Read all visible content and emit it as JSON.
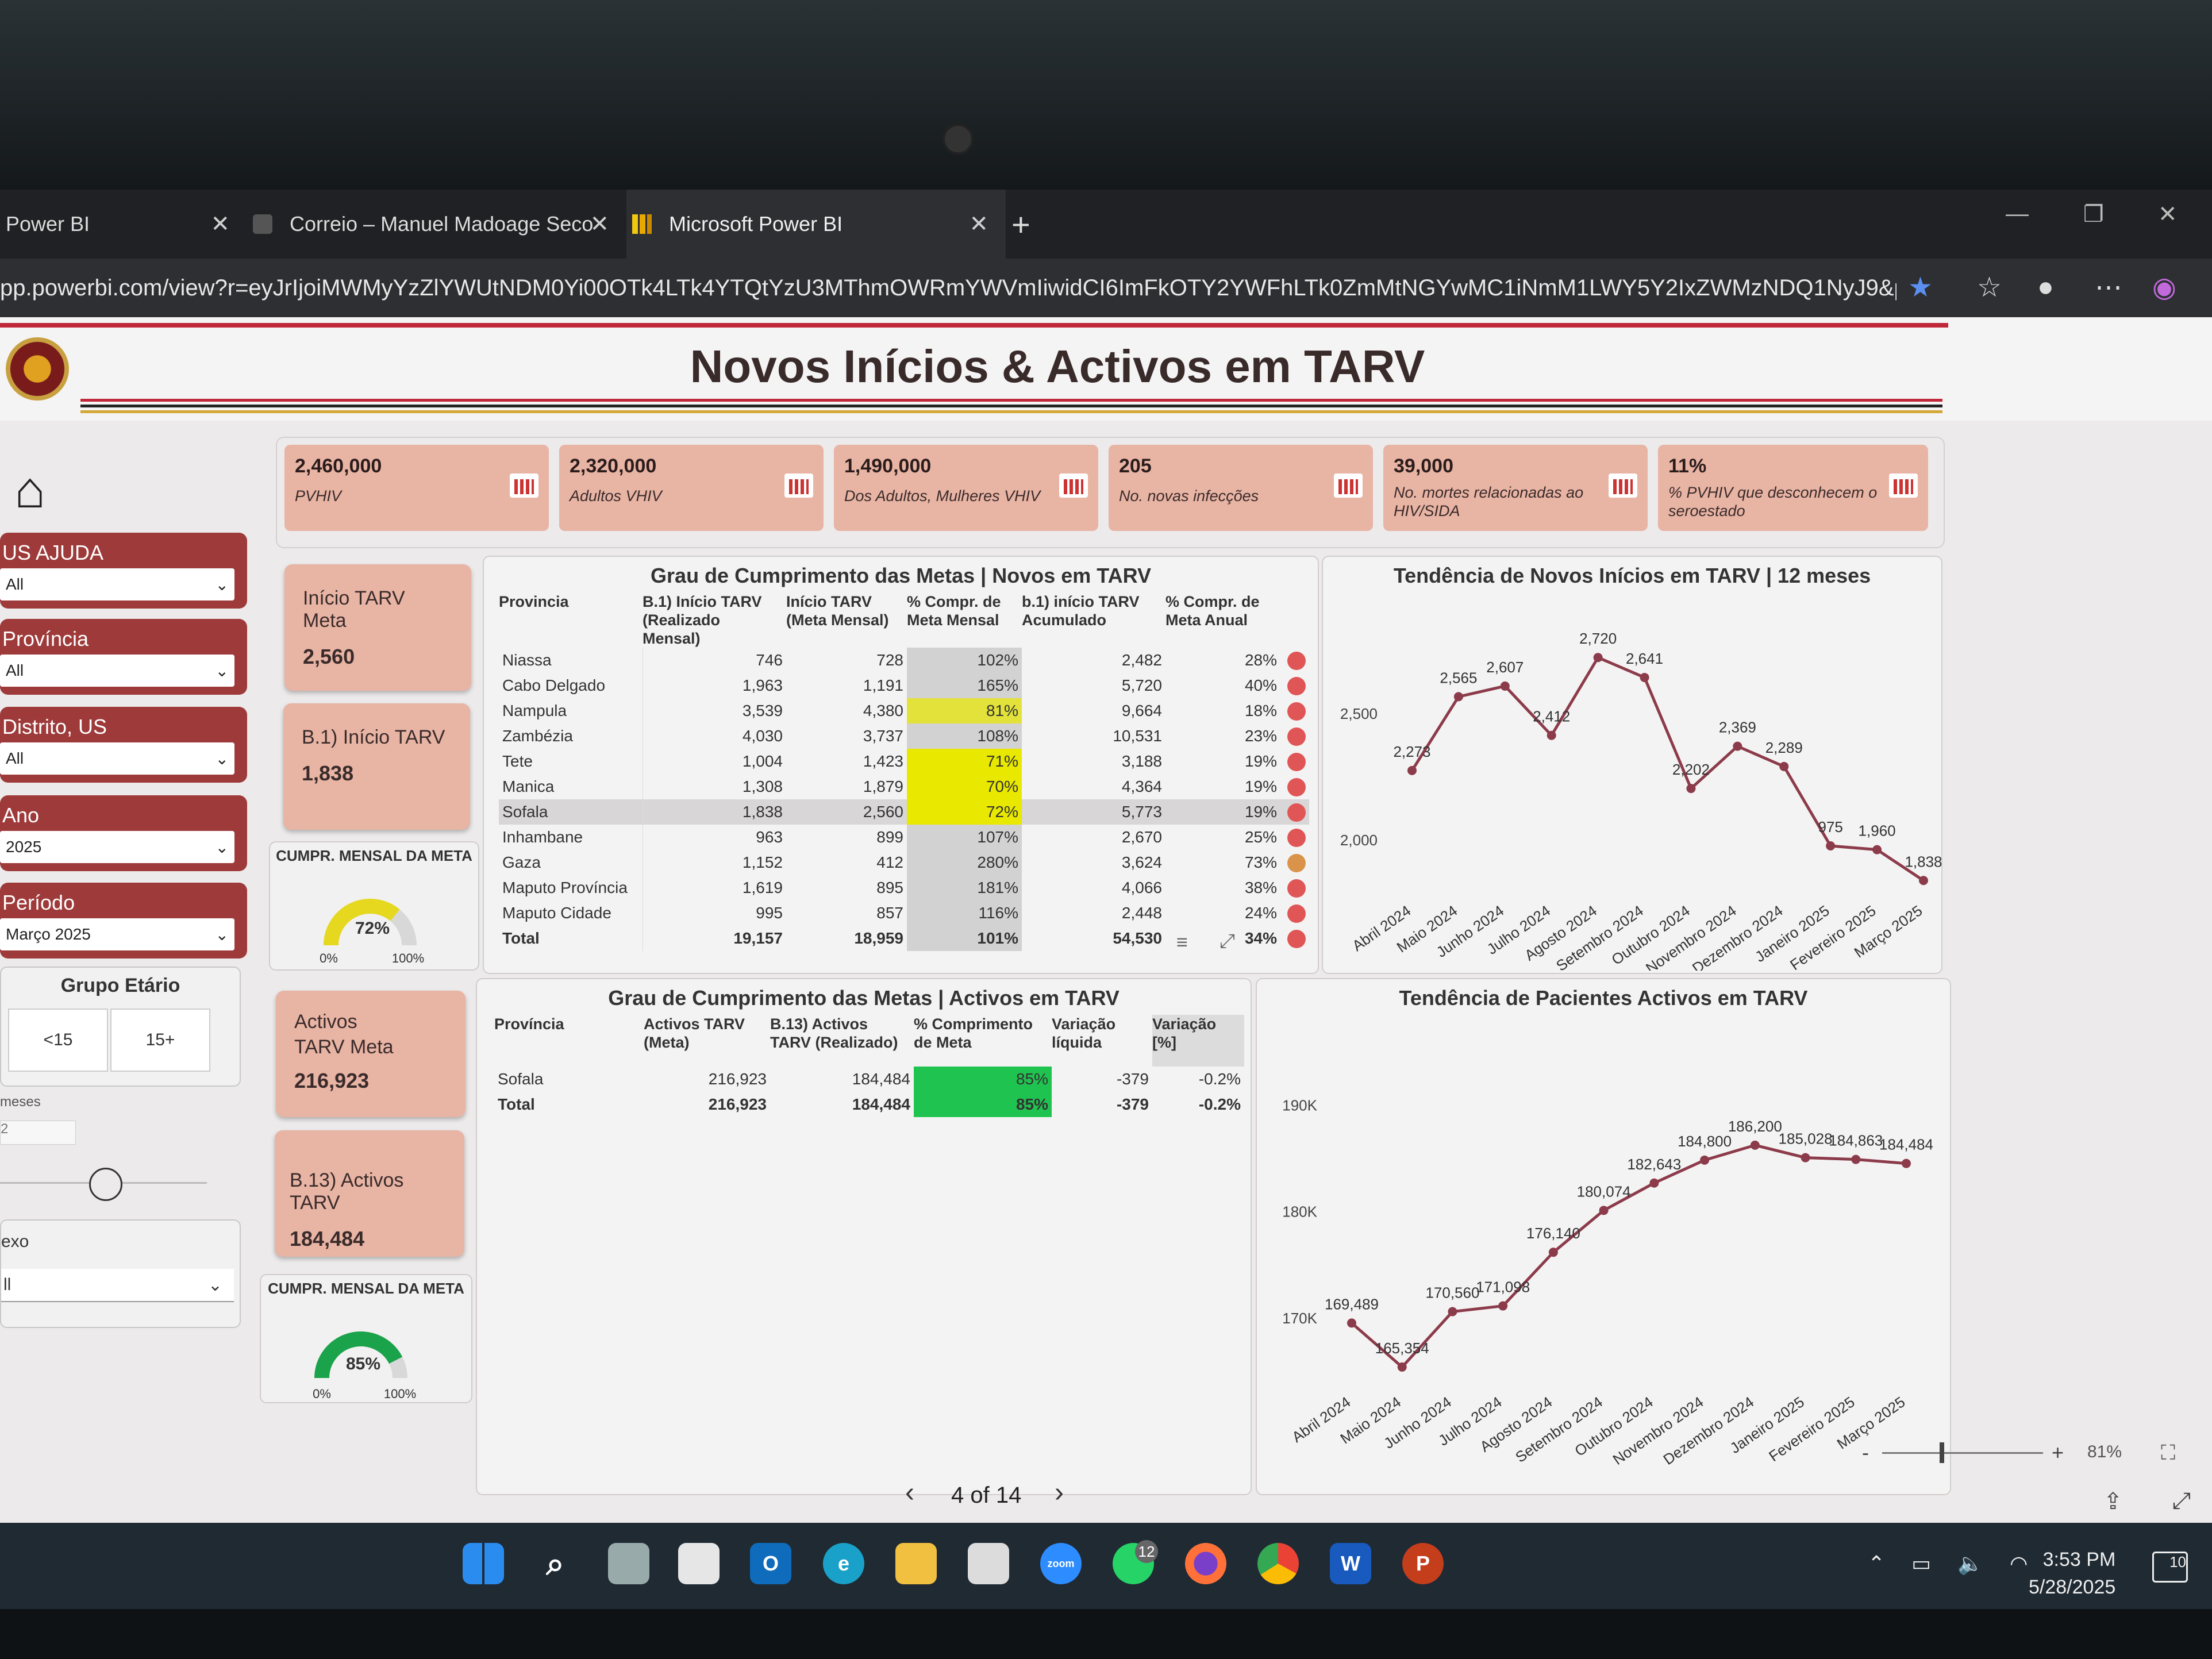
{
  "browser": {
    "tabs": [
      {
        "label": "Power BI"
      },
      {
        "label": "Correio – Manuel Madoage Seco"
      },
      {
        "label": "Microsoft Power BI"
      }
    ],
    "new_tab": "+",
    "url": "pp.powerbi.com/view?r=eyJrIjoiMWMyYzZlYWUtNDM0Yi00OTk4LTk4YTQtYzU3MThmOWRmYWVmIiwidCI6ImFkOTY2YWFhLTk0ZmMtNGYwMC1iNmM1LWY5Y2IxZWMzNDQ1NyJ9&pageNa..."
  },
  "report": {
    "title": "Novos Inícios & Activos em TARV",
    "filters": [
      {
        "label": "US AJUDA",
        "value": "All"
      },
      {
        "label": "Província",
        "value": "All"
      },
      {
        "label": "Distrito, US",
        "value": "All"
      },
      {
        "label": "Ano",
        "value": "2025"
      },
      {
        "label": "Período",
        "value": "Março 2025"
      }
    ],
    "age_group": {
      "label": "Grupo Etário",
      "options": [
        "<15",
        "15+"
      ]
    },
    "months_label": "meses",
    "months_value": "2",
    "sexo": {
      "label": "exo",
      "value": "ll"
    },
    "kpis": [
      {
        "value": "2,460,000",
        "label": "PVHIV"
      },
      {
        "value": "2,320,000",
        "label": "Adultos VHIV"
      },
      {
        "value": "1,490,000",
        "label": "Dos Adultos, Mulheres VHIV"
      },
      {
        "value": "205",
        "label": "No. novas infecções"
      },
      {
        "value": "39,000",
        "label": "No. mortes relacionadas ao HIV/SIDA"
      },
      {
        "value": "11%",
        "label": "% PVHIV que desconhecem o seroestado"
      }
    ],
    "cards": {
      "inicio_meta": {
        "title": "Início TARV Meta",
        "value": "2,560"
      },
      "inicio_tarv": {
        "title": "B.1) Início TARV",
        "value": "1,838"
      },
      "activos_meta": {
        "title": "Activos TARV Meta",
        "value": "216,923"
      },
      "activos_tarv": {
        "title": "B.13) Activos TARV",
        "value": "184,484"
      }
    },
    "gauge1": {
      "title": "CUMPR. MENSAL DA META",
      "value_label": "72%",
      "value": 0.72,
      "min": "0%",
      "max": "100%",
      "color": "#e6d81e"
    },
    "gauge2": {
      "title": "CUMPR. MENSAL DA META",
      "value_label": "85%",
      "value": 0.85,
      "min": "0%",
      "max": "100%",
      "color": "#1aa34a"
    },
    "novos_table": {
      "title": "Grau de Cumprimento das Metas | Novos em TARV",
      "headers": [
        "Provincia",
        "B.1) Início TARV (Realizado Mensal)",
        "Início TARV (Meta Mensal)",
        "% Compr. de Meta Mensal",
        "b.1) início TARV Acumulado",
        "% Compr. de Meta Anual"
      ],
      "rows": [
        [
          "Niassa",
          "746",
          "728",
          "102%",
          "2,482",
          "28%"
        ],
        [
          "Cabo Delgado",
          "1,963",
          "1,191",
          "165%",
          "5,720",
          "40%"
        ],
        [
          "Nampula",
          "3,539",
          "4,380",
          "81%",
          "9,664",
          "18%"
        ],
        [
          "Zambézia",
          "4,030",
          "3,737",
          "108%",
          "10,531",
          "23%"
        ],
        [
          "Tete",
          "1,004",
          "1,423",
          "71%",
          "3,188",
          "19%"
        ],
        [
          "Manica",
          "1,308",
          "1,879",
          "70%",
          "4,364",
          "19%"
        ],
        [
          "Sofala",
          "1,838",
          "2,560",
          "72%",
          "5,773",
          "19%"
        ],
        [
          "Inhambane",
          "963",
          "899",
          "107%",
          "2,670",
          "25%"
        ],
        [
          "Gaza",
          "1,152",
          "412",
          "280%",
          "3,624",
          "73%"
        ],
        [
          "Maputo Província",
          "1,619",
          "895",
          "181%",
          "4,066",
          "38%"
        ],
        [
          "Maputo Cidade",
          "995",
          "857",
          "116%",
          "2,448",
          "24%"
        ],
        [
          "Total",
          "19,157",
          "18,959",
          "101%",
          "54,530",
          "34%"
        ]
      ]
    },
    "activos_table": {
      "title": "Grau de Cumprimento das Metas | Activos em TARV",
      "headers": [
        "Província",
        "Activos TARV (Meta)",
        "B.13) Activos TARV (Realizado)",
        "% Comprimento de Meta",
        "Variação líquida",
        "Variação [%]"
      ],
      "rows": [
        [
          "Sofala",
          "216,923",
          "184,484",
          "85%",
          "-379",
          "-0.2%"
        ],
        [
          "Total",
          "216,923",
          "184,484",
          "85%",
          "-379",
          "-0.2%"
        ]
      ]
    },
    "pager": {
      "label": "4 of 14"
    },
    "zoom": "81%"
  },
  "chart_data": [
    {
      "type": "line",
      "title": "Tendência de Novos Inícios em TARV | 12 meses",
      "categories": [
        "Abril 2024",
        "Maio 2024",
        "Junho 2024",
        "Julho 2024",
        "Agosto 2024",
        "Setembro 2024",
        "Outubro 2024",
        "Novembro 2024",
        "Dezembro 2024",
        "Janeiro 2025",
        "Fevereiro 2025",
        "Março 2025"
      ],
      "values": [
        2273,
        2565,
        2607,
        2412,
        2720,
        2641,
        2202,
        2369,
        2289,
        1975,
        1960,
        1838
      ],
      "value_labels": [
        "2,273",
        "2,565",
        "2,607",
        "2,412",
        "2,720",
        "2,641",
        "2,202",
        "2,369",
        "2,289",
        "975",
        "1,960",
        "1,838"
      ],
      "yticks": [
        2000,
        2500
      ],
      "ytick_labels": [
        "2,000",
        "2,500"
      ],
      "ylim": [
        1800,
        2800
      ],
      "color": "#8c3b4a"
    },
    {
      "type": "line",
      "title": "Tendência de Pacientes Activos em TARV",
      "categories": [
        "Abril 2024",
        "Maio 2024",
        "Junho 2024",
        "Julho 2024",
        "Agosto 2024",
        "Setembro 2024",
        "Outubro 2024",
        "Novembro 2024",
        "Dezembro 2024",
        "Janeiro 2025",
        "Fevereiro 2025",
        "Março 2025"
      ],
      "values": [
        169489,
        165354,
        170560,
        171098,
        176140,
        180074,
        182643,
        184800,
        186200,
        185028,
        184863,
        184484
      ],
      "value_labels": [
        "169,489",
        "165,354",
        "170,560",
        "171,098",
        "176,140",
        "180,074",
        "182,643",
        "184,800",
        "186,200",
        "185,028",
        "184,863",
        "184,484"
      ],
      "yticks": [
        170000,
        180000,
        190000
      ],
      "ytick_labels": [
        "170K",
        "180K",
        "190K"
      ],
      "ylim": [
        164000,
        191000
      ],
      "color": "#8c3b4a"
    }
  ],
  "clock": {
    "time": "3:53 PM",
    "date": "5/28/2025"
  },
  "badges": {
    "whatsapp": "12",
    "notifications": "10"
  },
  "colors": {
    "accent_red": "#9e3a3a",
    "card": "#e8b4a4",
    "line": "#8c3b4a"
  }
}
